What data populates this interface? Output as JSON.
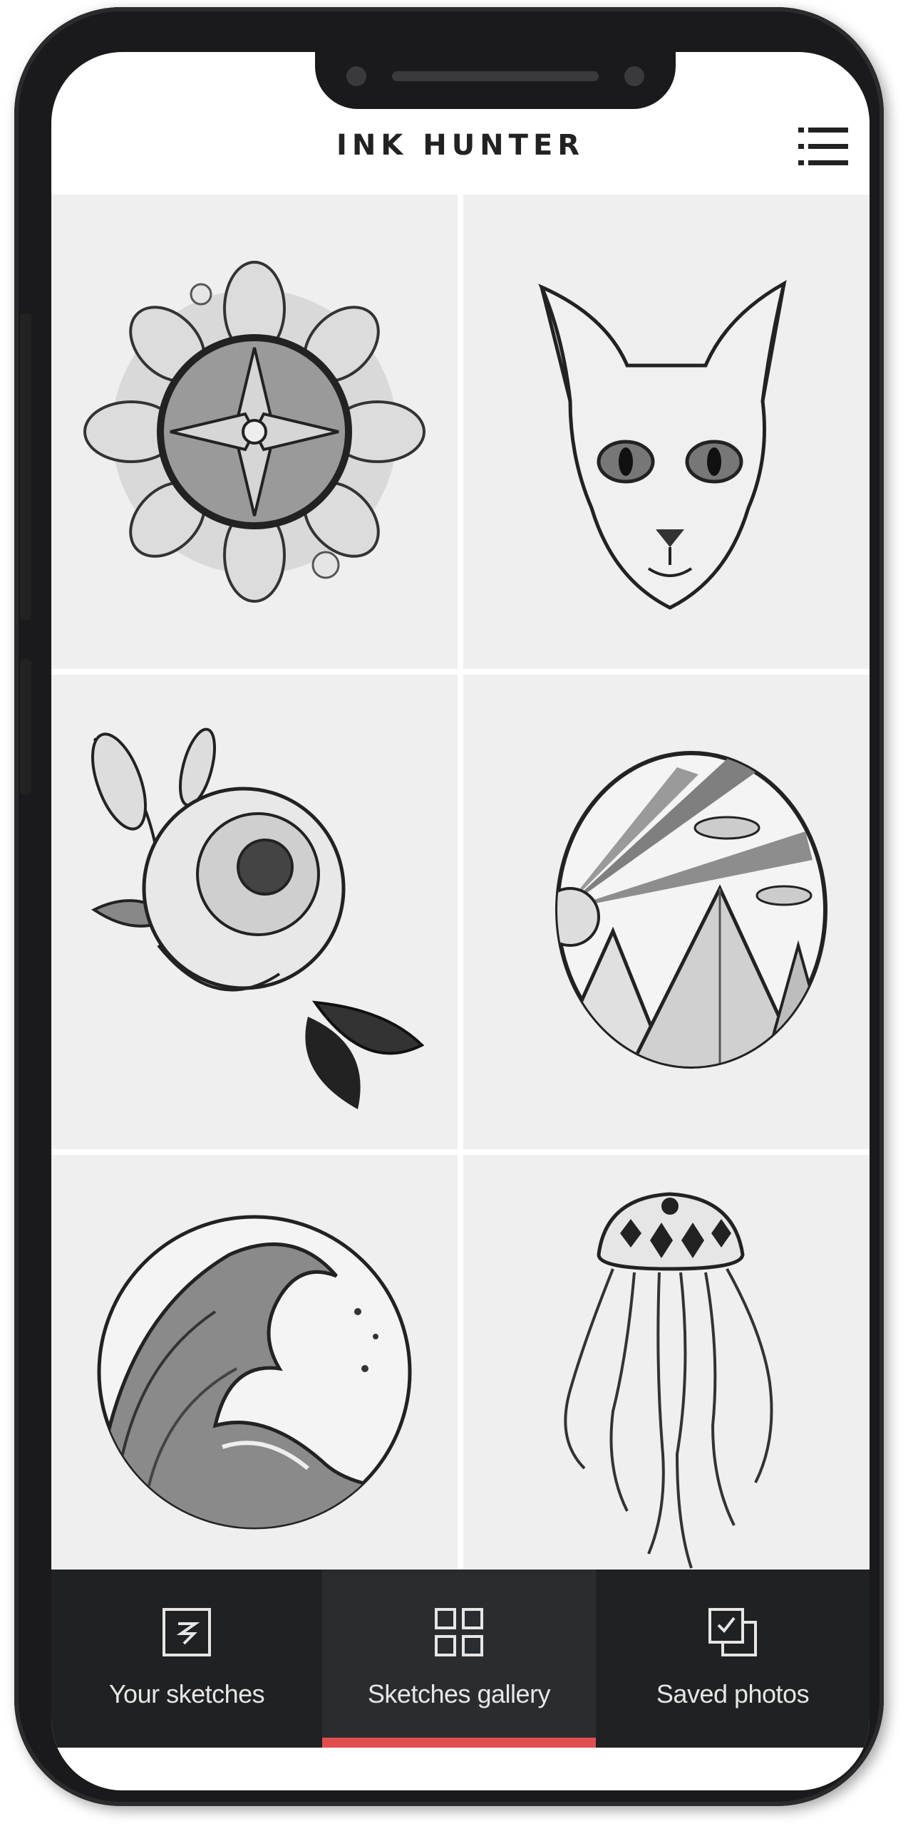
{
  "app": {
    "title": "INK HUNTER"
  },
  "header": {
    "menu_icon": "list-menu-icon"
  },
  "gallery": {
    "items": [
      {
        "subject": "mandala"
      },
      {
        "subject": "sphynx cat"
      },
      {
        "subject": "peony flower"
      },
      {
        "subject": "mountains sunrise"
      },
      {
        "subject": "wave"
      },
      {
        "subject": "jellyfish"
      }
    ]
  },
  "bottom_nav": {
    "items": [
      {
        "label": "Your sketches",
        "icon": "sketch-document-icon",
        "active": false
      },
      {
        "label": "Sketches gallery",
        "icon": "grid-icon",
        "active": true
      },
      {
        "label": "Saved photos",
        "icon": "saved-photos-icon",
        "active": false
      }
    ]
  },
  "colors": {
    "accent": "#e24d4d",
    "nav_bg": "#1f2122",
    "tile_bg": "#efefef"
  }
}
